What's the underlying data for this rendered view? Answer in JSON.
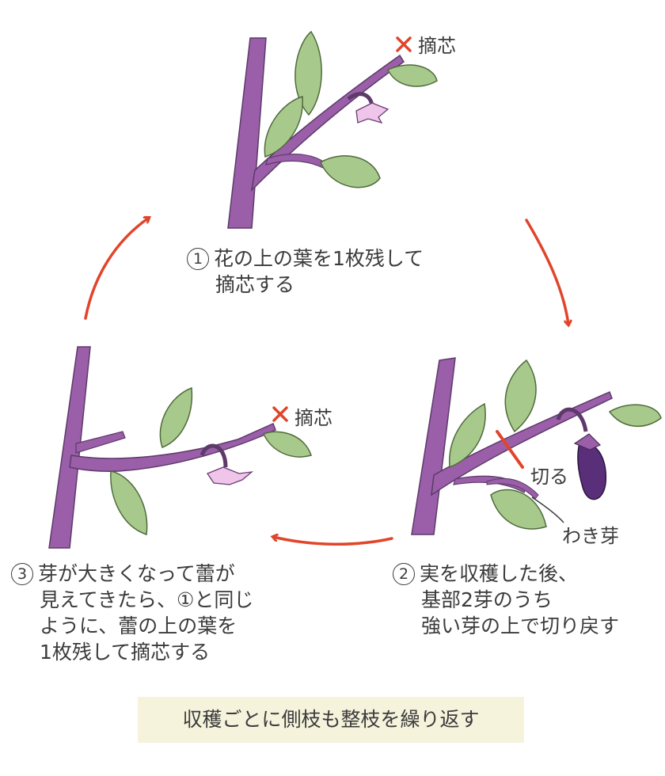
{
  "steps": [
    {
      "number": "1",
      "lines": [
        "花の上の葉を1枚残して",
        "摘芯する"
      ]
    },
    {
      "number": "2",
      "lines": [
        "実を収穫した後、",
        "基部2芽のうち",
        "強い芽の上で切り戻す"
      ]
    },
    {
      "number": "3",
      "lines": [
        "芽が大きくなって蕾が",
        "見えてきたら、①と同じ",
        "ように、蕾の上の葉を",
        "1枚残して摘芯する"
      ]
    }
  ],
  "labels": {
    "pinch_top": "摘芯",
    "pinch_left": "摘芯",
    "cut": "切る",
    "side_bud": "わき芽"
  },
  "footer_note": "収穫ごとに側枝も整枝を繰り返す",
  "colors": {
    "stem": "#9a5fa8",
    "leaf": "#a8c98c",
    "arrow": "#e0452a",
    "note_bg": "#f6f3dd",
    "eggplant": "#5a2f7a"
  }
}
